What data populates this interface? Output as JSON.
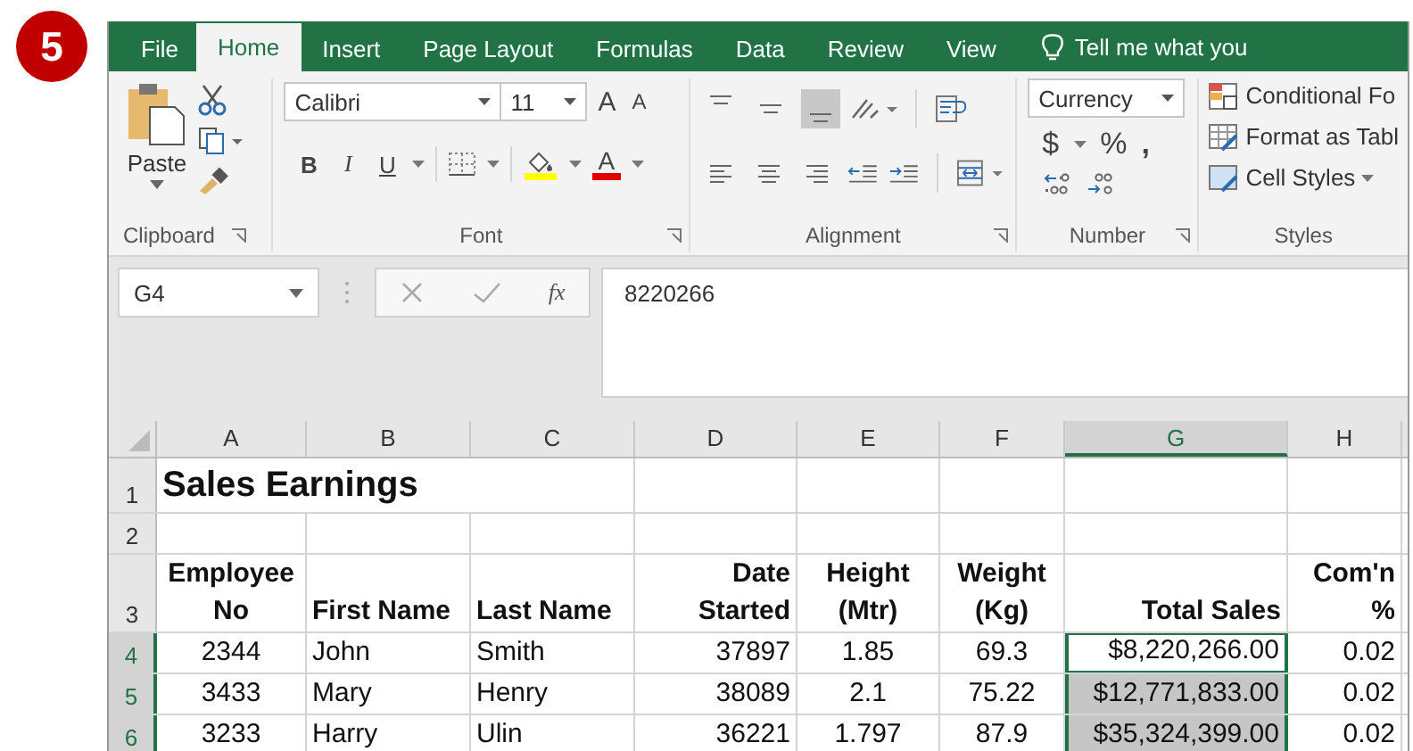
{
  "step_badge": "5",
  "tabs": [
    {
      "label": "File",
      "selected": false
    },
    {
      "label": "Home",
      "selected": true
    },
    {
      "label": "Insert",
      "selected": false
    },
    {
      "label": "Page Layout",
      "selected": false
    },
    {
      "label": "Formulas",
      "selected": false
    },
    {
      "label": "Data",
      "selected": false
    },
    {
      "label": "Review",
      "selected": false
    },
    {
      "label": "View",
      "selected": false
    }
  ],
  "tell_me": "Tell me what you",
  "clipboard": {
    "paste": "Paste",
    "label": "Clipboard"
  },
  "font": {
    "name": "Calibri",
    "size": "11",
    "grow": "A",
    "shrink": "A",
    "bold": "B",
    "italic": "I",
    "underline": "U",
    "color_letter": "A",
    "label": "Font"
  },
  "alignment": {
    "vertical": [
      {
        "kind": "top",
        "selected": false
      },
      {
        "kind": "middle",
        "selected": false
      },
      {
        "kind": "bottom",
        "selected": true
      }
    ],
    "horizontal": [
      {
        "kind": "left",
        "selected": false
      },
      {
        "kind": "center",
        "selected": false
      },
      {
        "kind": "right",
        "selected": false
      }
    ],
    "label": "Alignment"
  },
  "number": {
    "format": "Currency",
    "dollar": "$",
    "percent": "%",
    "comma": ",",
    "label": "Number"
  },
  "styles": {
    "items": [
      {
        "kind": "conditional",
        "label": "Conditional Fo"
      },
      {
        "kind": "table",
        "label": "Format as Tabl"
      },
      {
        "kind": "cell",
        "label": "Cell Styles"
      }
    ],
    "label": "Styles"
  },
  "formula_bar": {
    "name_box": "G4",
    "fx": "fx",
    "value": "8220266"
  },
  "columns": [
    {
      "label": "A",
      "selected": false
    },
    {
      "label": "B",
      "selected": false
    },
    {
      "label": "C",
      "selected": false
    },
    {
      "label": "D",
      "selected": false
    },
    {
      "label": "E",
      "selected": false
    },
    {
      "label": "F",
      "selected": false
    },
    {
      "label": "G",
      "selected": true
    },
    {
      "label": "H",
      "selected": false
    }
  ],
  "rows": [
    {
      "header": "1",
      "kind": "title",
      "selected": false,
      "cells": [
        "Sales Earnings"
      ]
    },
    {
      "header": "2",
      "kind": "blank",
      "selected": false,
      "cells": []
    },
    {
      "header": "3",
      "kind": "heading",
      "selected": false,
      "cells": [
        "Employee\nNo",
        "First Name",
        "Last Name",
        "Date\nStarted",
        "Height\n(Mtr)",
        "Weight\n(Kg)",
        "Total Sales",
        "Com'n\n%"
      ]
    },
    {
      "header": "4",
      "kind": "data",
      "selected": true,
      "active": true,
      "cells": [
        "2344",
        "John",
        "Smith",
        "37897",
        "1.85",
        "69.3",
        "$8,220,266.00",
        "0.02"
      ]
    },
    {
      "header": "5",
      "kind": "data",
      "selected": true,
      "active": false,
      "cells": [
        "3433",
        "Mary",
        "Henry",
        "38089",
        "2.1",
        "75.22",
        "$12,771,833.00",
        "0.02"
      ]
    },
    {
      "header": "6",
      "kind": "data",
      "selected": true,
      "active": false,
      "cells": [
        "3233",
        "Harry",
        "Ulin",
        "36221",
        "1.797",
        "87.9",
        "$35,324,399.00",
        "0.02"
      ]
    }
  ]
}
